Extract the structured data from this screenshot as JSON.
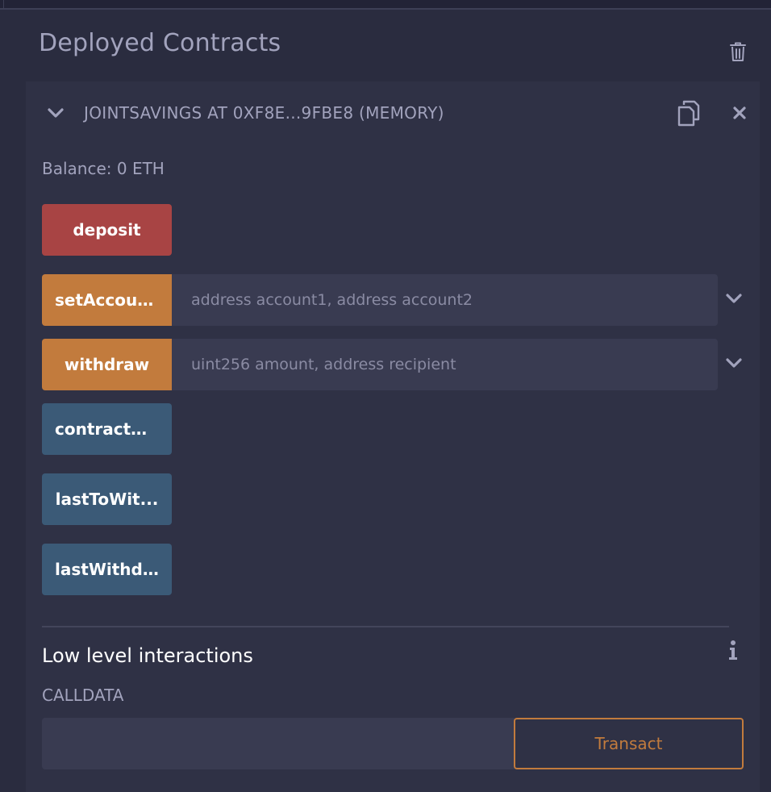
{
  "section": {
    "title": "Deployed Contracts",
    "trash_icon": "trash-icon"
  },
  "contract": {
    "name": "JOINTSAVINGS AT 0XF8E...9FBE8 (MEMORY)",
    "balance": "Balance: 0 ETH",
    "icons": {
      "toggle": "chevron-down-icon",
      "copy": "copy-icon",
      "close": "close-icon"
    },
    "functions": [
      {
        "label": "deposit",
        "kind": "payable"
      },
      {
        "label": "setAccounts",
        "kind": "nonpayable",
        "placeholder": "address account1, address account2"
      },
      {
        "label": "withdraw",
        "kind": "nonpayable",
        "placeholder": "uint256 amount, address recipient"
      },
      {
        "label": "contractBa...",
        "kind": "view"
      },
      {
        "label": "lastToWit...",
        "kind": "view"
      },
      {
        "label": "lastWithdr...",
        "kind": "view"
      }
    ]
  },
  "low_level": {
    "title": "Low level interactions",
    "info_icon": "info-icon",
    "calldata_label": "CALLDATA",
    "calldata_value": "",
    "transact_label": "Transact"
  },
  "colors": {
    "background": "#2a2c3f",
    "panel": "#2f3145",
    "payable": "#a84444",
    "nonpayable": "#c27b3d",
    "view": "#3b5a77",
    "input": "#393b51",
    "muted_text": "#a2a3bd"
  }
}
